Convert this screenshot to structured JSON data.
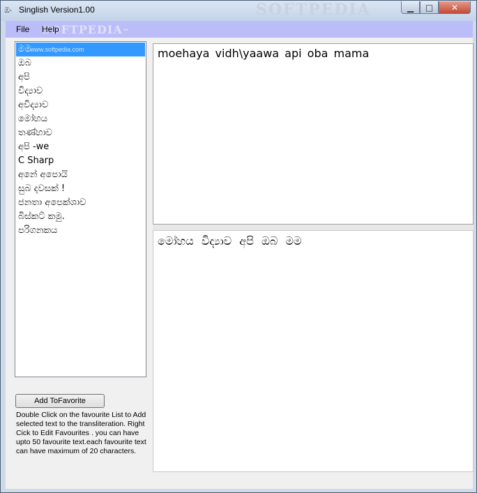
{
  "window": {
    "title": "Singlish Version1.00",
    "app_icon": "ඹං",
    "title_watermark": "SOFTPEDIA",
    "controls": {
      "minimize": "▁",
      "maximize": "□",
      "close": "✕"
    }
  },
  "menu": {
    "items": [
      "File",
      "Help"
    ],
    "watermark": "SOFTPEDIA",
    "watermark_suffix": "™"
  },
  "favorites": {
    "items": [
      "මම",
      "ඔබ",
      "අපි",
      "විද්‍යාව",
      "අවිද්‍යාව",
      "මෝහය",
      "තණ්හාව",
      "අපි -we",
      "C Sharp",
      "අනේ අපොයි",
      "සුබ දවසක් !",
      "ජනතා අපෙක්ශාව",
      "බිස්කට් කමු.",
      "පරිගනකය"
    ],
    "selected_watermark": "www.softpedia.com"
  },
  "add_button": {
    "label": "Add ToFavorite"
  },
  "help_text": "Double Click on the favourite List to Add selected text to the transliteration.  Right Cick to Edit Favourites . you can have upto 50 favourite text.each favourite text can have maximum of 20 characters.",
  "input_text": "moehaya vidh\\yaawa api oba mama",
  "output_text": "මෝහය විද්‍යාව අපි ඔබ මම"
}
